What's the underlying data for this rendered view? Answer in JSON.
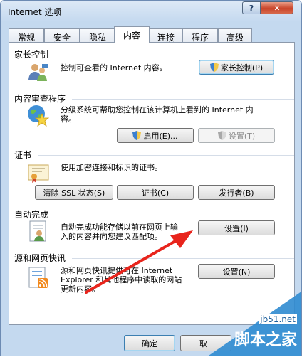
{
  "window": {
    "title": "Internet 选项",
    "help_label": "?",
    "close_label": "✕"
  },
  "tabs": [
    {
      "label": "常规"
    },
    {
      "label": "安全"
    },
    {
      "label": "隐私"
    },
    {
      "label": "内容",
      "active": true
    },
    {
      "label": "连接"
    },
    {
      "label": "程序"
    },
    {
      "label": "高级"
    }
  ],
  "parental": {
    "title": "家长控制",
    "desc": "控制可查看的 Internet 内容。",
    "button": "家长控制(P)",
    "icon": "users-icon"
  },
  "advisor": {
    "title": "内容审查程序",
    "desc_line1": "分级系统可帮助您控制在该计算机上看到的 Internet 内",
    "desc_line2": "容。",
    "enable_button": "启用(E)...",
    "settings_button": "设置(T)",
    "icon": "globe-star-icon"
  },
  "certificates": {
    "title": "证书",
    "desc": "使用加密连接和标识的证书。",
    "clear_ssl_button": "清除 SSL 状态(S)",
    "certs_button": "证书(C)",
    "publishers_button": "发行者(B)",
    "icon": "certificate-icon"
  },
  "autocomplete": {
    "title": "自动完成",
    "desc_line1": "自动完成功能存储以前在网页上输",
    "desc_line2": "入的内容并向您建议匹配项。",
    "settings_button": "设置(I)",
    "icon": "autocomplete-icon"
  },
  "feeds": {
    "title": "源和网页快讯",
    "desc_line1": "源和网页快讯提供可在 Internet",
    "desc_line2": "Explorer 和其他程序中读取的网站",
    "desc_line3": "更新内容。",
    "settings_button": "设置(N)",
    "icon": "feeds-icon"
  },
  "footer": {
    "ok_button": "确定",
    "cancel_button": "取"
  },
  "watermark": {
    "site": "jb51.net",
    "name": "脚本之家"
  },
  "colors": {
    "accent": "#3c7fb1",
    "arrow": "#e8241c"
  }
}
